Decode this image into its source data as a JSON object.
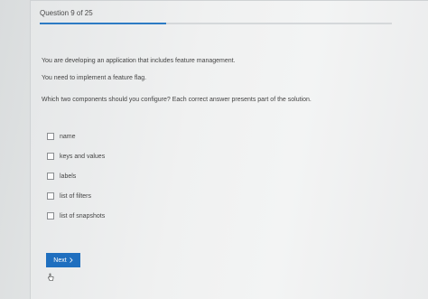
{
  "header": {
    "question_counter": "Question 9 of 25",
    "progress_fraction": 0.36
  },
  "question": {
    "stem_lines": [
      "You are developing an application that includes feature management.",
      "You need to implement a feature flag.",
      "Which two components should you configure? Each correct answer presents part of the solution."
    ],
    "options": [
      {
        "label": "name",
        "checked": false
      },
      {
        "label": "keys and values",
        "checked": false
      },
      {
        "label": "labels",
        "checked": false
      },
      {
        "label": "list of filters",
        "checked": false
      },
      {
        "label": "list of snapshots",
        "checked": false
      }
    ]
  },
  "footer": {
    "next_label": "Next",
    "next_icon": "chevron-right-icon",
    "accent_color": "#1f6fbf"
  },
  "cursor": {
    "icon": "hand-pointer-icon"
  }
}
